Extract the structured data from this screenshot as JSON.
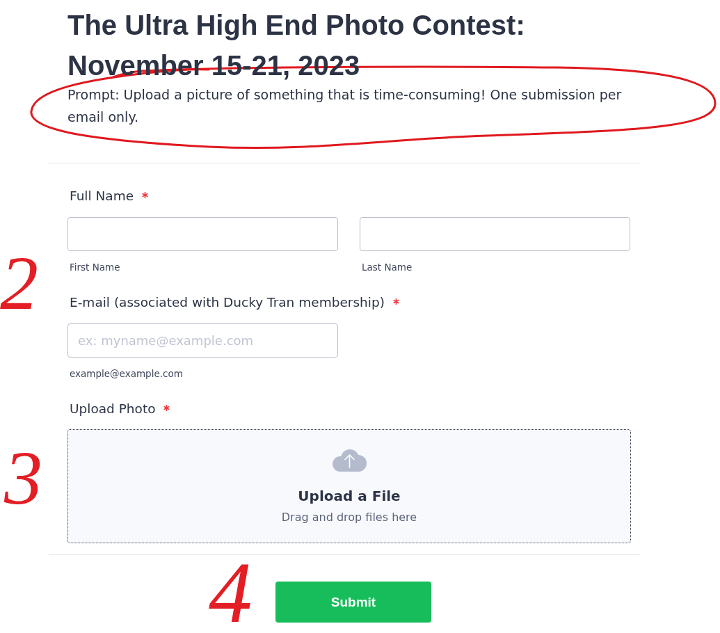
{
  "header": {
    "title": "The Ultra High End Photo Contest: November 15-21, 2023",
    "prompt": "Prompt: Upload a picture of something that is time-consuming! One submission per email only."
  },
  "fields": [
    {
      "kind": "text",
      "label": "Full Name",
      "required": true,
      "inputs": [
        {
          "sublabel": "First Name"
        },
        {
          "sublabel": "Last Name"
        }
      ]
    },
    {
      "kind": "text",
      "label": "E-mail (associated with Ducky Tran membership)",
      "required": true,
      "inputs": [
        {
          "placeholder": "ex: myname@example.com",
          "sublabel": "example@example.com"
        }
      ]
    },
    {
      "kind": "upload",
      "label": "Upload Photo",
      "required": true,
      "title": "Upload a File",
      "hint": "Drag and drop files here"
    }
  ],
  "submit_button": {
    "label": "Submit"
  },
  "annotations": [
    {
      "kind": "ellipse"
    },
    {
      "kind": "number",
      "text": "2"
    },
    {
      "kind": "number",
      "text": "3"
    },
    {
      "kind": "number",
      "text": "4"
    }
  ]
}
